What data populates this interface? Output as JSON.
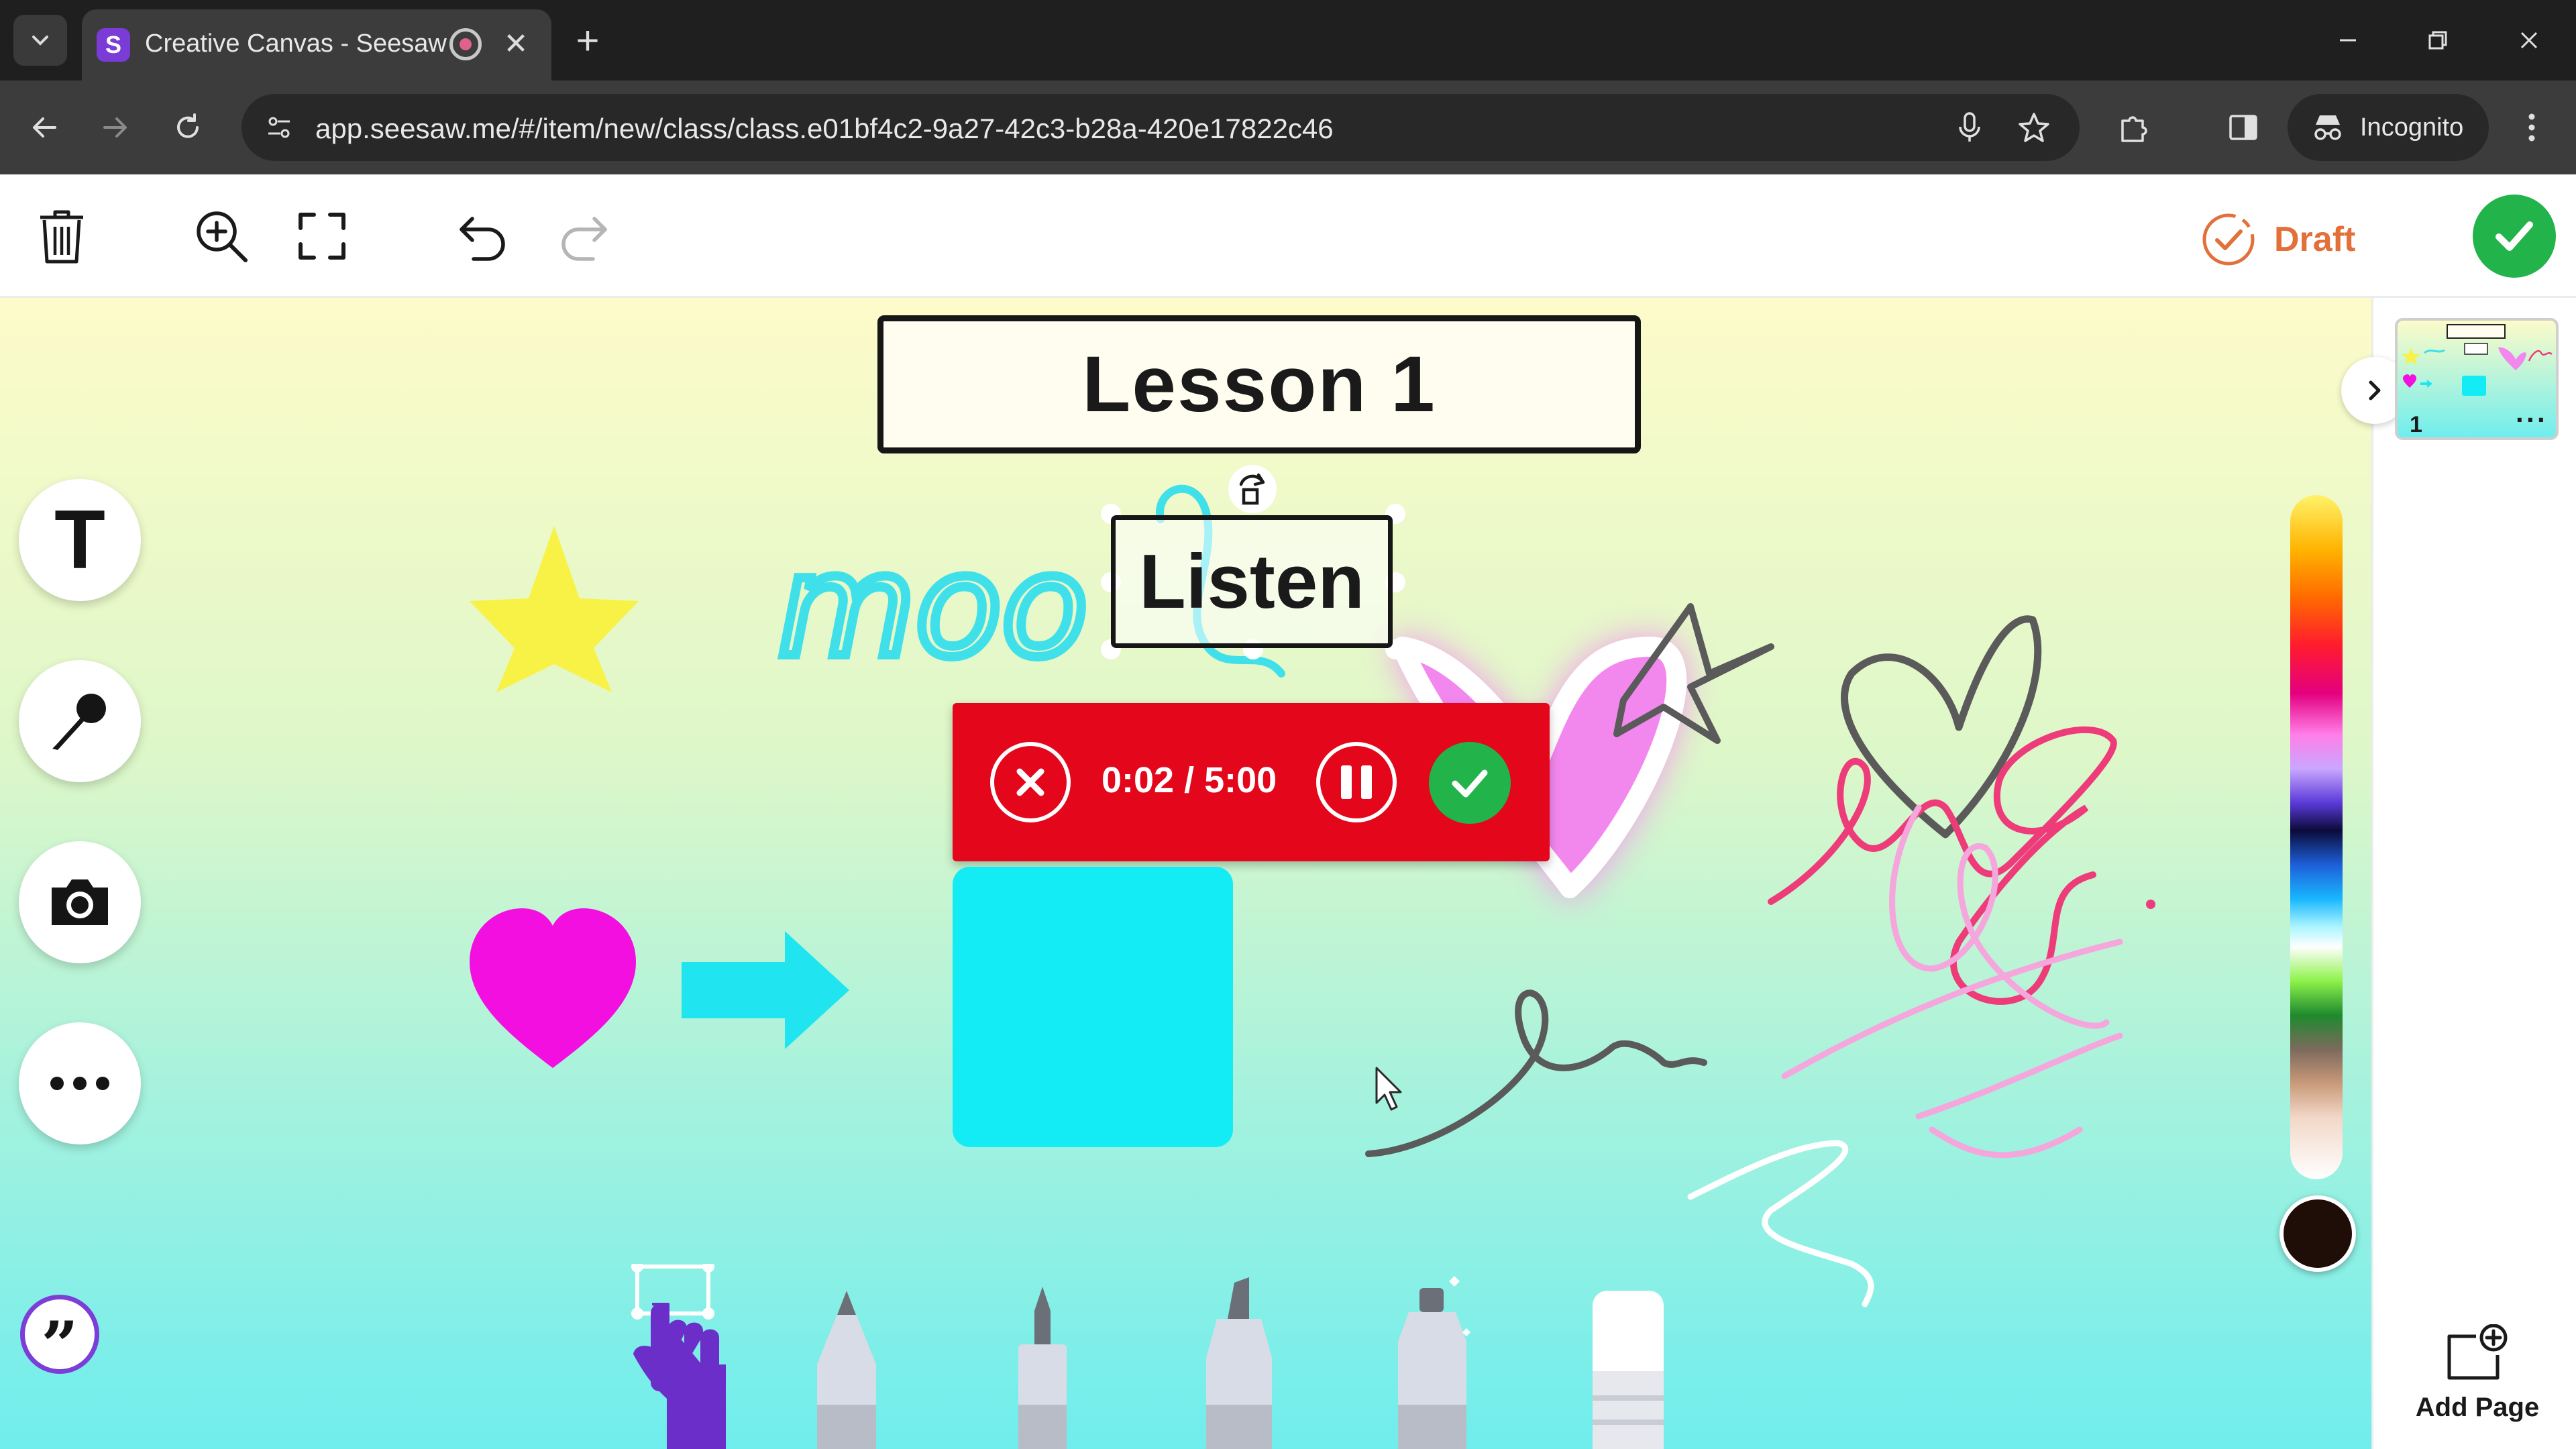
{
  "browser": {
    "tab_title": "Creative Canvas - Seesaw",
    "tab_favicon_letter": "S",
    "url": "app.seesaw.me/#/item/new/class/class.e01bf4c2-9a27-42c3-b28a-420e17822c46",
    "incognito_label": "Incognito"
  },
  "appbar": {
    "draft_label": "Draft"
  },
  "canvas": {
    "lesson_title": "Lesson 1",
    "listen_label": "Listen",
    "scribble_text": "moo"
  },
  "recording": {
    "elapsed": "0:02",
    "separator": " / ",
    "limit": "5:00"
  },
  "side_tools": {
    "text_glyph": "T",
    "quote_glyph": "”"
  },
  "pages": {
    "current_page_number": "1",
    "more_glyph": "···",
    "add_page_label": "Add Page"
  },
  "colors": {
    "selected_color": "#1e0e07",
    "done_green": "#22b34b",
    "record_red": "#e4061b",
    "draft_orange": "#e1703a",
    "shape_cyan": "#13ecf4",
    "heart_magenta": "#f20fe0",
    "star_yellow": "#f7f245"
  }
}
